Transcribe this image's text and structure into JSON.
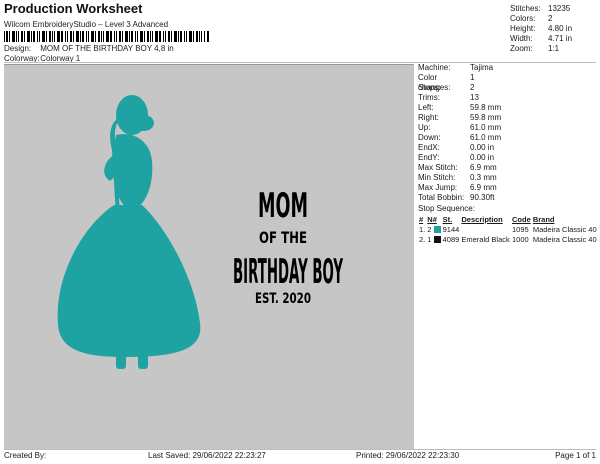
{
  "header": {
    "title": "Production Worksheet",
    "subtitle": "Wilcom EmbroideryStudio – Level 3 Advanced",
    "design_label": "Design:",
    "design_value": "MOM OF THE BIRTHDAY BOY 4,8 in",
    "colorway_label": "Colorway:",
    "colorway_value": "Colorway 1"
  },
  "top_stats": [
    {
      "label": "Stitches:",
      "value": "13235"
    },
    {
      "label": "Colors:",
      "value": "2"
    },
    {
      "label": "Height:",
      "value": "4.80 in"
    },
    {
      "label": "Width:",
      "value": "4.71 in"
    },
    {
      "label": "Zoom:",
      "value": "1:1"
    }
  ],
  "design_text": {
    "line1": "MOM",
    "line2": "OF THE",
    "line3": "BIRTHDAY BOY",
    "line4": "EST. 2020"
  },
  "machine_stats": [
    {
      "label": "Machine:",
      "value": "Tajima"
    },
    {
      "label": "Color changes:",
      "value": "1"
    },
    {
      "label": "Stops:",
      "value": "2"
    },
    {
      "label": "Trims:",
      "value": "13"
    },
    {
      "label": "Left:",
      "value": "59.8 mm"
    },
    {
      "label": "Right:",
      "value": "59.8 mm"
    },
    {
      "label": "Up:",
      "value": "61.0 mm"
    },
    {
      "label": "Down:",
      "value": "61.0 mm"
    },
    {
      "label": "EndX:",
      "value": "0.00 in"
    },
    {
      "label": "EndY:",
      "value": "0.00 in"
    },
    {
      "label": "Max Stitch:",
      "value": "6.9 mm"
    },
    {
      "label": "Min Stitch:",
      "value": "0.3 mm"
    },
    {
      "label": "Max Jump:",
      "value": "6.9 mm"
    },
    {
      "label": "Total Bobbin:",
      "value": "90.30ft"
    }
  ],
  "stop_sequence": {
    "title": "Stop Sequence:",
    "headers": [
      "#",
      "N#",
      "St.",
      "Description",
      "Code",
      "Brand"
    ],
    "rows": [
      {
        "num": "1.",
        "n": "2",
        "swatch": "#1fa2a2",
        "st": "9144",
        "desc": "",
        "code": "1095",
        "brand": "Madeira Classic 40"
      },
      {
        "num": "2.",
        "n": "1",
        "swatch": "#111111",
        "st": "4089",
        "desc": "Emerald Black",
        "code": "1000",
        "brand": "Madeira Classic 40"
      }
    ]
  },
  "footer": {
    "created_by": "Created By:",
    "last_saved": "Last Saved: 29/06/2022 22:23:27",
    "printed": "Printed: 29/06/2022 22:23:30",
    "page": "Page 1 of 1"
  },
  "colors": {
    "teal": "#1fa2a2",
    "canvas": "#c6c6c6"
  }
}
